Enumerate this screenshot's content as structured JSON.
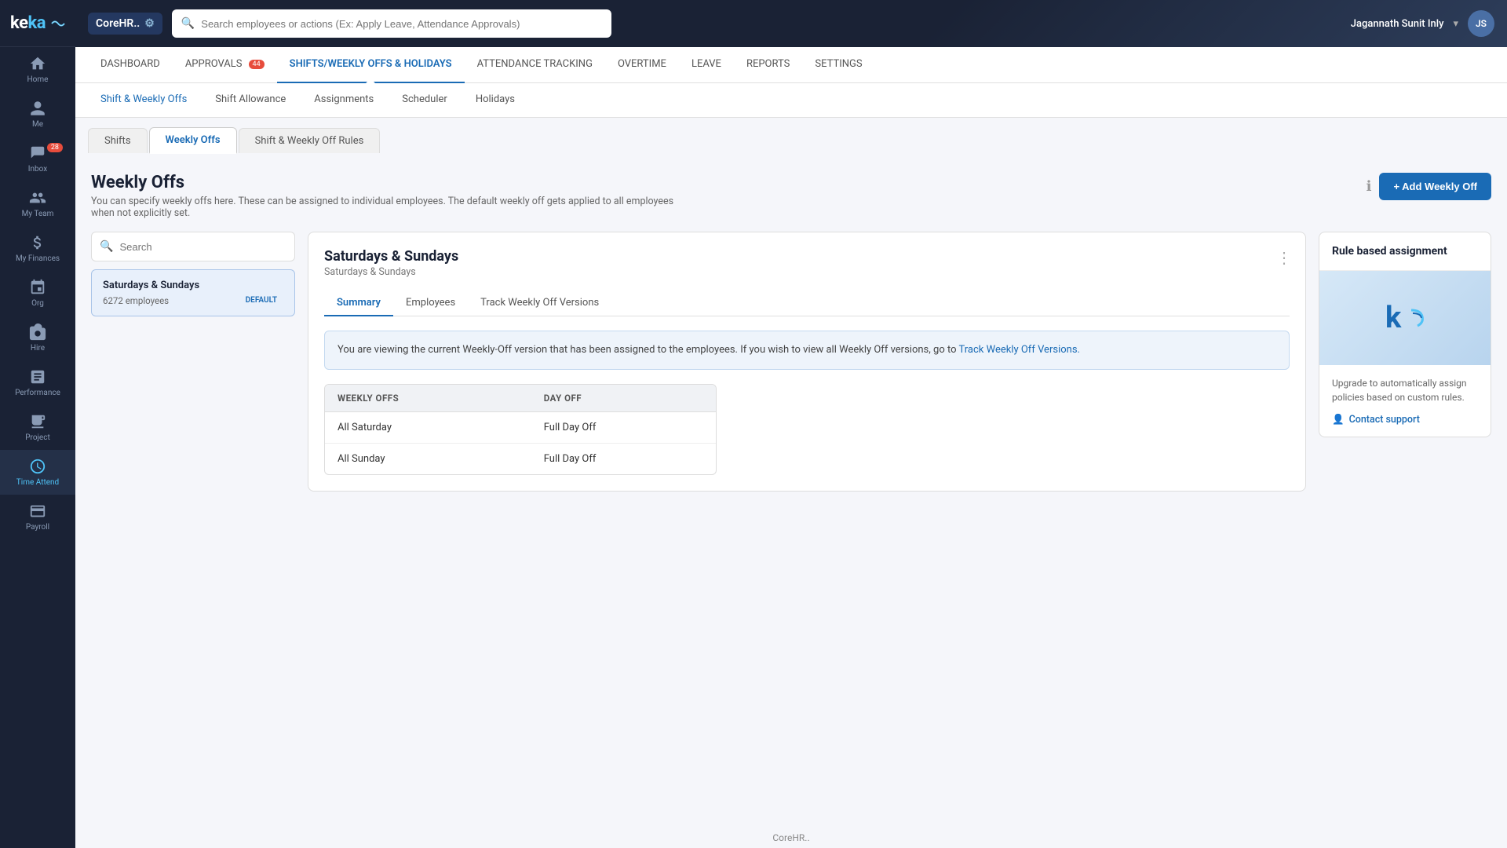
{
  "sidebar": {
    "logo": "keka",
    "items": [
      {
        "id": "home",
        "label": "Home",
        "icon": "home",
        "active": false
      },
      {
        "id": "me",
        "label": "Me",
        "icon": "person",
        "active": false
      },
      {
        "id": "inbox",
        "label": "Inbox",
        "icon": "inbox",
        "active": false,
        "badge": "28"
      },
      {
        "id": "my-team",
        "label": "My Team",
        "icon": "team",
        "active": false
      },
      {
        "id": "my-finances",
        "label": "My Finances",
        "icon": "finances",
        "active": false
      },
      {
        "id": "org",
        "label": "Org",
        "icon": "org",
        "active": false
      },
      {
        "id": "hire",
        "label": "Hire",
        "icon": "hire",
        "active": false
      },
      {
        "id": "performance",
        "label": "Performance",
        "icon": "performance",
        "active": false
      },
      {
        "id": "project",
        "label": "Project",
        "icon": "project",
        "active": false
      },
      {
        "id": "time-attend",
        "label": "Time Attend",
        "icon": "clock",
        "active": true
      },
      {
        "id": "payroll",
        "label": "Payroll",
        "icon": "payroll",
        "active": false
      }
    ]
  },
  "topbar": {
    "app_name": "CoreHR..",
    "search_placeholder": "Search employees or actions (Ex: Apply Leave, Attendance Approvals)",
    "user_name": "Jagannath Sunit Inly",
    "user_initials": "JS"
  },
  "nav_tabs": [
    {
      "id": "dashboard",
      "label": "DASHBOARD",
      "active": false
    },
    {
      "id": "approvals",
      "label": "APPROVALS",
      "active": false,
      "badge": "44"
    },
    {
      "id": "shifts",
      "label": "SHIFTS/WEEKLY OFFS & HOLIDAYS",
      "active": true
    },
    {
      "id": "attendance",
      "label": "ATTENDANCE TRACKING",
      "active": false
    },
    {
      "id": "overtime",
      "label": "OVERTIME",
      "active": false
    },
    {
      "id": "leave",
      "label": "LEAVE",
      "active": false
    },
    {
      "id": "reports",
      "label": "REPORTS",
      "active": false
    },
    {
      "id": "settings",
      "label": "SETTINGS",
      "active": false
    }
  ],
  "sub_nav_tabs": [
    {
      "id": "shift-weekly",
      "label": "Shift & Weekly Offs",
      "active": true
    },
    {
      "id": "shift-allowance",
      "label": "Shift Allowance",
      "active": false
    },
    {
      "id": "assignments",
      "label": "Assignments",
      "active": false
    },
    {
      "id": "scheduler",
      "label": "Scheduler",
      "active": false
    },
    {
      "id": "holidays",
      "label": "Holidays",
      "active": false
    }
  ],
  "inner_tabs": [
    {
      "id": "shifts-tab",
      "label": "Shifts",
      "active": false
    },
    {
      "id": "weekly-offs-tab",
      "label": "Weekly Offs",
      "active": true
    },
    {
      "id": "shift-rules-tab",
      "label": "Shift & Weekly Off Rules",
      "active": false
    }
  ],
  "page": {
    "title": "Weekly Offs",
    "subtitle": "You can specify weekly offs here. These can be assigned to individual employees. The default weekly off gets applied to all employees when not explicitly set.",
    "add_button": "+ Add Weekly Off"
  },
  "search": {
    "placeholder": "Search"
  },
  "policies": [
    {
      "id": "sat-sun",
      "name": "Saturdays & Sundays",
      "employee_count": "6272 employees",
      "is_default": true,
      "default_label": "DEFAULT",
      "active": true
    }
  ],
  "detail": {
    "title": "Saturdays & Sundays",
    "subtitle": "Saturdays & Sundays",
    "tabs": [
      {
        "id": "summary",
        "label": "Summary",
        "active": true
      },
      {
        "id": "employees",
        "label": "Employees",
        "active": false
      },
      {
        "id": "track-versions",
        "label": "Track Weekly Off Versions",
        "active": false
      }
    ],
    "info_text": "You are viewing the current Weekly-Off version that has been assigned to the employees. If you wish to view all Weekly Off versions, go to ",
    "info_link_text": "Track Weekly Off Versions.",
    "table": {
      "col1_header": "WEEKLY OFFS",
      "col2_header": "DAY OFF",
      "rows": [
        {
          "weekly_off": "All Saturday",
          "day_off": "Full Day Off"
        },
        {
          "weekly_off": "All Sunday",
          "day_off": "Full Day Off"
        }
      ]
    }
  },
  "widget": {
    "title": "Rule based assignment",
    "description": "Upgrade to automatically assign policies based on custom rules.",
    "link_label": "Contact support",
    "icon": "🎯"
  },
  "footer": {
    "text": "CoreHR.."
  }
}
